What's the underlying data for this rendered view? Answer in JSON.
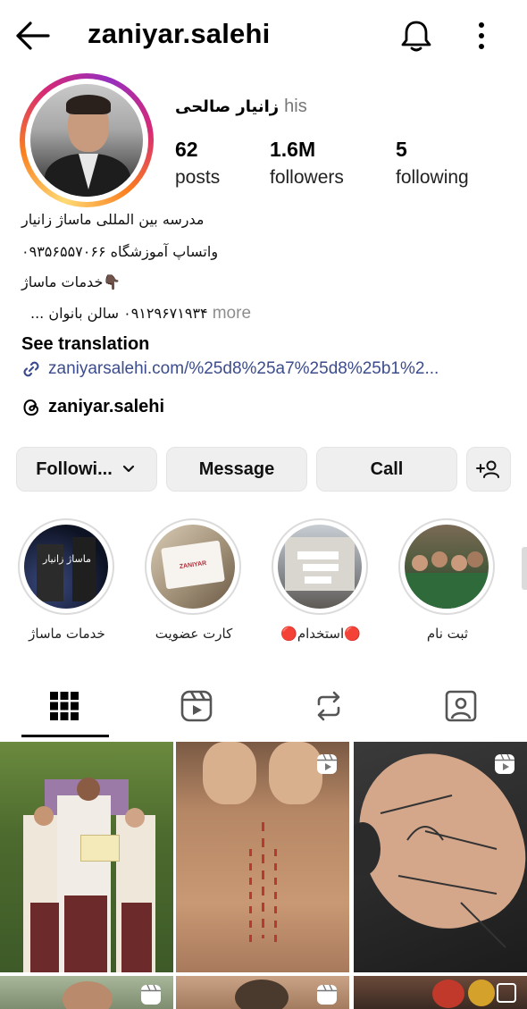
{
  "header": {
    "username": "zaniyar.salehi",
    "back_icon": "arrow-left-icon",
    "bell_icon": "bell-icon",
    "more_icon": "vertical-dots-icon"
  },
  "profile": {
    "full_name": "زانیار صالحی",
    "pronoun": "his",
    "stats": {
      "posts_count": "62",
      "posts_label": "posts",
      "followers_count": "1.6M",
      "followers_label": "followers",
      "following_count": "5",
      "following_label": "following"
    },
    "bio": {
      "line1": "مدرسه بین المللی ماساژ زانیار",
      "line2": "واتساپ آموزشگاه ۰۹۳۵۶۵۵۷۰۶۶",
      "line3": "👇🏿خدمات ماساژ",
      "line4": "۰۹۱۲۹۶۷۱۹۳۴ سالن بانوان ...",
      "more": "more"
    },
    "see_translation": "See translation",
    "link": "zaniyarsalehi.com/%25d8%25a7%25d8%25b1%2...",
    "threads_handle": "zaniyar.salehi"
  },
  "actions": {
    "following_label": "Followi...",
    "message_label": "Message",
    "call_label": "Call"
  },
  "highlights": [
    {
      "label": "خدمات ماساژ",
      "image_text": "ماساژ زانیار"
    },
    {
      "label": "کارت عضویت",
      "image_text": "ZANIYAR"
    },
    {
      "label": "🔴استخدام🔴"
    },
    {
      "label": "ثبت نام"
    }
  ],
  "tabs": [
    "grid-icon",
    "reels-icon",
    "reposts-icon",
    "tagged-icon"
  ],
  "colors": {
    "link": "#3c4c8c",
    "button_bg": "#efefef",
    "muted_text": "#8e8e8e"
  }
}
